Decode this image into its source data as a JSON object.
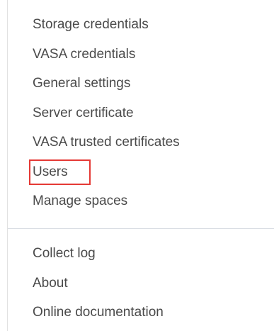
{
  "menu": {
    "items": [
      {
        "label": "Storage credentials"
      },
      {
        "label": "VASA credentials"
      },
      {
        "label": "General settings"
      },
      {
        "label": "Server certificate"
      },
      {
        "label": "VASA trusted certificates"
      },
      {
        "label": "Users",
        "highlighted": true
      },
      {
        "label": "Manage spaces"
      }
    ],
    "secondary_items": [
      {
        "label": "Collect log"
      },
      {
        "label": "About"
      },
      {
        "label": "Online documentation"
      }
    ]
  },
  "colors": {
    "text": "#4a4a4a",
    "highlight_border": "#e53935",
    "divider": "#d9dde3"
  }
}
